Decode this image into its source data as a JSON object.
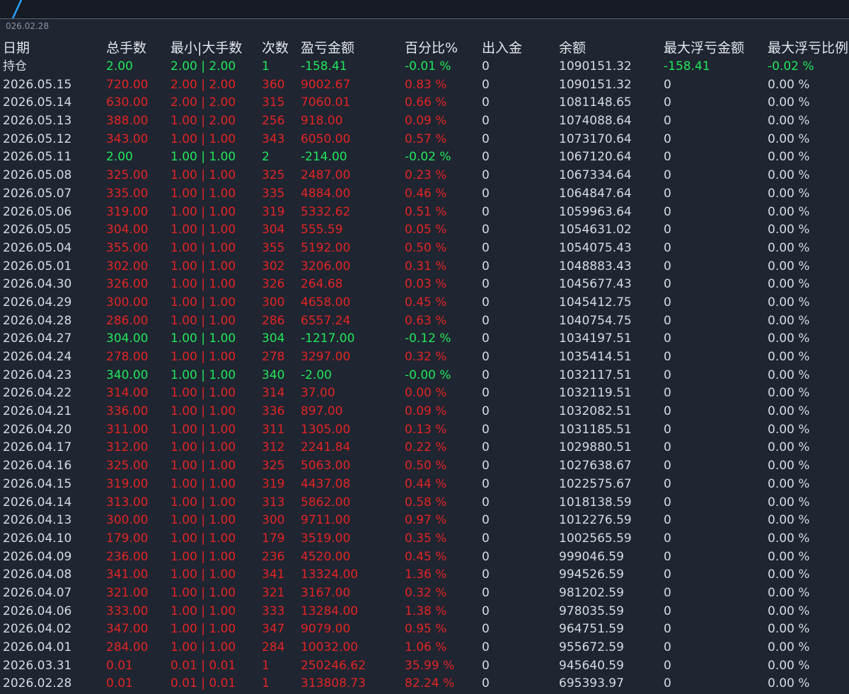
{
  "date_tag": "026.02.28",
  "columns": [
    "日期",
    "总手数",
    "最小|大手数",
    "次数",
    "盈亏金额",
    "百分比%",
    "出入金",
    "余额",
    "最大浮亏金额",
    "最大浮亏比例"
  ],
  "colors": {
    "loss": "#e12525",
    "gain": "#22e65c",
    "neutral": "#d7dbe2",
    "background": "#1f2531"
  },
  "rows": [
    {
      "date": "持仓",
      "lots": "2.00",
      "minmax": "2.00 | 2.00",
      "count": "1",
      "pnl": "-158.41",
      "pct": "-0.01 %",
      "flow": "0",
      "balance": "1090151.32",
      "float_amt": "-158.41",
      "float_pct": "-0.02 %",
      "color": "gain",
      "float_color": "gain"
    },
    {
      "date": "2026.05.15",
      "lots": "720.00",
      "minmax": "2.00 | 2.00",
      "count": "360",
      "pnl": "9002.67",
      "pct": "0.83 %",
      "flow": "0",
      "balance": "1090151.32",
      "float_amt": "0",
      "float_pct": "0.00 %",
      "color": "loss",
      "float_color": "neutral"
    },
    {
      "date": "2026.05.14",
      "lots": "630.00",
      "minmax": "2.00 | 2.00",
      "count": "315",
      "pnl": "7060.01",
      "pct": "0.66 %",
      "flow": "0",
      "balance": "1081148.65",
      "float_amt": "0",
      "float_pct": "0.00 %",
      "color": "loss",
      "float_color": "neutral"
    },
    {
      "date": "2026.05.13",
      "lots": "388.00",
      "minmax": "1.00 | 2.00",
      "count": "256",
      "pnl": "918.00",
      "pct": "0.09 %",
      "flow": "0",
      "balance": "1074088.64",
      "float_amt": "0",
      "float_pct": "0.00 %",
      "color": "loss",
      "float_color": "neutral"
    },
    {
      "date": "2026.05.12",
      "lots": "343.00",
      "minmax": "1.00 | 1.00",
      "count": "343",
      "pnl": "6050.00",
      "pct": "0.57 %",
      "flow": "0",
      "balance": "1073170.64",
      "float_amt": "0",
      "float_pct": "0.00 %",
      "color": "loss",
      "float_color": "neutral"
    },
    {
      "date": "2026.05.11",
      "lots": "2.00",
      "minmax": "1.00 | 1.00",
      "count": "2",
      "pnl": "-214.00",
      "pct": "-0.02 %",
      "flow": "0",
      "balance": "1067120.64",
      "float_amt": "0",
      "float_pct": "0.00 %",
      "color": "gain",
      "float_color": "neutral"
    },
    {
      "date": "2026.05.08",
      "lots": "325.00",
      "minmax": "1.00 | 1.00",
      "count": "325",
      "pnl": "2487.00",
      "pct": "0.23 %",
      "flow": "0",
      "balance": "1067334.64",
      "float_amt": "0",
      "float_pct": "0.00 %",
      "color": "loss",
      "float_color": "neutral"
    },
    {
      "date": "2026.05.07",
      "lots": "335.00",
      "minmax": "1.00 | 1.00",
      "count": "335",
      "pnl": "4884.00",
      "pct": "0.46 %",
      "flow": "0",
      "balance": "1064847.64",
      "float_amt": "0",
      "float_pct": "0.00 %",
      "color": "loss",
      "float_color": "neutral"
    },
    {
      "date": "2026.05.06",
      "lots": "319.00",
      "minmax": "1.00 | 1.00",
      "count": "319",
      "pnl": "5332.62",
      "pct": "0.51 %",
      "flow": "0",
      "balance": "1059963.64",
      "float_amt": "0",
      "float_pct": "0.00 %",
      "color": "loss",
      "float_color": "neutral"
    },
    {
      "date": "2026.05.05",
      "lots": "304.00",
      "minmax": "1.00 | 1.00",
      "count": "304",
      "pnl": "555.59",
      "pct": "0.05 %",
      "flow": "0",
      "balance": "1054631.02",
      "float_amt": "0",
      "float_pct": "0.00 %",
      "color": "loss",
      "float_color": "neutral"
    },
    {
      "date": "2026.05.04",
      "lots": "355.00",
      "minmax": "1.00 | 1.00",
      "count": "355",
      "pnl": "5192.00",
      "pct": "0.50 %",
      "flow": "0",
      "balance": "1054075.43",
      "float_amt": "0",
      "float_pct": "0.00 %",
      "color": "loss",
      "float_color": "neutral"
    },
    {
      "date": "2026.05.01",
      "lots": "302.00",
      "minmax": "1.00 | 1.00",
      "count": "302",
      "pnl": "3206.00",
      "pct": "0.31 %",
      "flow": "0",
      "balance": "1048883.43",
      "float_amt": "0",
      "float_pct": "0.00 %",
      "color": "loss",
      "float_color": "neutral"
    },
    {
      "date": "2026.04.30",
      "lots": "326.00",
      "minmax": "1.00 | 1.00",
      "count": "326",
      "pnl": "264.68",
      "pct": "0.03 %",
      "flow": "0",
      "balance": "1045677.43",
      "float_amt": "0",
      "float_pct": "0.00 %",
      "color": "loss",
      "float_color": "neutral"
    },
    {
      "date": "2026.04.29",
      "lots": "300.00",
      "minmax": "1.00 | 1.00",
      "count": "300",
      "pnl": "4658.00",
      "pct": "0.45 %",
      "flow": "0",
      "balance": "1045412.75",
      "float_amt": "0",
      "float_pct": "0.00 %",
      "color": "loss",
      "float_color": "neutral"
    },
    {
      "date": "2026.04.28",
      "lots": "286.00",
      "minmax": "1.00 | 1.00",
      "count": "286",
      "pnl": "6557.24",
      "pct": "0.63 %",
      "flow": "0",
      "balance": "1040754.75",
      "float_amt": "0",
      "float_pct": "0.00 %",
      "color": "loss",
      "float_color": "neutral"
    },
    {
      "date": "2026.04.27",
      "lots": "304.00",
      "minmax": "1.00 | 1.00",
      "count": "304",
      "pnl": "-1217.00",
      "pct": "-0.12 %",
      "flow": "0",
      "balance": "1034197.51",
      "float_amt": "0",
      "float_pct": "0.00 %",
      "color": "gain",
      "float_color": "neutral"
    },
    {
      "date": "2026.04.24",
      "lots": "278.00",
      "minmax": "1.00 | 1.00",
      "count": "278",
      "pnl": "3297.00",
      "pct": "0.32 %",
      "flow": "0",
      "balance": "1035414.51",
      "float_amt": "0",
      "float_pct": "0.00 %",
      "color": "loss",
      "float_color": "neutral"
    },
    {
      "date": "2026.04.23",
      "lots": "340.00",
      "minmax": "1.00 | 1.00",
      "count": "340",
      "pnl": "-2.00",
      "pct": "-0.00 %",
      "flow": "0",
      "balance": "1032117.51",
      "float_amt": "0",
      "float_pct": "0.00 %",
      "color": "gain",
      "float_color": "neutral"
    },
    {
      "date": "2026.04.22",
      "lots": "314.00",
      "minmax": "1.00 | 1.00",
      "count": "314",
      "pnl": "37.00",
      "pct": "0.00 %",
      "flow": "0",
      "balance": "1032119.51",
      "float_amt": "0",
      "float_pct": "0.00 %",
      "color": "loss",
      "float_color": "neutral"
    },
    {
      "date": "2026.04.21",
      "lots": "336.00",
      "minmax": "1.00 | 1.00",
      "count": "336",
      "pnl": "897.00",
      "pct": "0.09 %",
      "flow": "0",
      "balance": "1032082.51",
      "float_amt": "0",
      "float_pct": "0.00 %",
      "color": "loss",
      "float_color": "neutral"
    },
    {
      "date": "2026.04.20",
      "lots": "311.00",
      "minmax": "1.00 | 1.00",
      "count": "311",
      "pnl": "1305.00",
      "pct": "0.13 %",
      "flow": "0",
      "balance": "1031185.51",
      "float_amt": "0",
      "float_pct": "0.00 %",
      "color": "loss",
      "float_color": "neutral"
    },
    {
      "date": "2026.04.17",
      "lots": "312.00",
      "minmax": "1.00 | 1.00",
      "count": "312",
      "pnl": "2241.84",
      "pct": "0.22 %",
      "flow": "0",
      "balance": "1029880.51",
      "float_amt": "0",
      "float_pct": "0.00 %",
      "color": "loss",
      "float_color": "neutral"
    },
    {
      "date": "2026.04.16",
      "lots": "325.00",
      "minmax": "1.00 | 1.00",
      "count": "325",
      "pnl": "5063.00",
      "pct": "0.50 %",
      "flow": "0",
      "balance": "1027638.67",
      "float_amt": "0",
      "float_pct": "0.00 %",
      "color": "loss",
      "float_color": "neutral"
    },
    {
      "date": "2026.04.15",
      "lots": "319.00",
      "minmax": "1.00 | 1.00",
      "count": "319",
      "pnl": "4437.08",
      "pct": "0.44 %",
      "flow": "0",
      "balance": "1022575.67",
      "float_amt": "0",
      "float_pct": "0.00 %",
      "color": "loss",
      "float_color": "neutral"
    },
    {
      "date": "2026.04.14",
      "lots": "313.00",
      "minmax": "1.00 | 1.00",
      "count": "313",
      "pnl": "5862.00",
      "pct": "0.58 %",
      "flow": "0",
      "balance": "1018138.59",
      "float_amt": "0",
      "float_pct": "0.00 %",
      "color": "loss",
      "float_color": "neutral"
    },
    {
      "date": "2026.04.13",
      "lots": "300.00",
      "minmax": "1.00 | 1.00",
      "count": "300",
      "pnl": "9711.00",
      "pct": "0.97 %",
      "flow": "0",
      "balance": "1012276.59",
      "float_amt": "0",
      "float_pct": "0.00 %",
      "color": "loss",
      "float_color": "neutral"
    },
    {
      "date": "2026.04.10",
      "lots": "179.00",
      "minmax": "1.00 | 1.00",
      "count": "179",
      "pnl": "3519.00",
      "pct": "0.35 %",
      "flow": "0",
      "balance": "1002565.59",
      "float_amt": "0",
      "float_pct": "0.00 %",
      "color": "loss",
      "float_color": "neutral"
    },
    {
      "date": "2026.04.09",
      "lots": "236.00",
      "minmax": "1.00 | 1.00",
      "count": "236",
      "pnl": "4520.00",
      "pct": "0.45 %",
      "flow": "0",
      "balance": "999046.59",
      "float_amt": "0",
      "float_pct": "0.00 %",
      "color": "loss",
      "float_color": "neutral"
    },
    {
      "date": "2026.04.08",
      "lots": "341.00",
      "minmax": "1.00 | 1.00",
      "count": "341",
      "pnl": "13324.00",
      "pct": "1.36 %",
      "flow": "0",
      "balance": "994526.59",
      "float_amt": "0",
      "float_pct": "0.00 %",
      "color": "loss",
      "float_color": "neutral"
    },
    {
      "date": "2026.04.07",
      "lots": "321.00",
      "minmax": "1.00 | 1.00",
      "count": "321",
      "pnl": "3167.00",
      "pct": "0.32 %",
      "flow": "0",
      "balance": "981202.59",
      "float_amt": "0",
      "float_pct": "0.00 %",
      "color": "loss",
      "float_color": "neutral"
    },
    {
      "date": "2026.04.06",
      "lots": "333.00",
      "minmax": "1.00 | 1.00",
      "count": "333",
      "pnl": "13284.00",
      "pct": "1.38 %",
      "flow": "0",
      "balance": "978035.59",
      "float_amt": "0",
      "float_pct": "0.00 %",
      "color": "loss",
      "float_color": "neutral"
    },
    {
      "date": "2026.04.02",
      "lots": "347.00",
      "minmax": "1.00 | 1.00",
      "count": "347",
      "pnl": "9079.00",
      "pct": "0.95 %",
      "flow": "0",
      "balance": "964751.59",
      "float_amt": "0",
      "float_pct": "0.00 %",
      "color": "loss",
      "float_color": "neutral"
    },
    {
      "date": "2026.04.01",
      "lots": "284.00",
      "minmax": "1.00 | 1.00",
      "count": "284",
      "pnl": "10032.00",
      "pct": "1.06 %",
      "flow": "0",
      "balance": "955672.59",
      "float_amt": "0",
      "float_pct": "0.00 %",
      "color": "loss",
      "float_color": "neutral"
    },
    {
      "date": "2026.03.31",
      "lots": "0.01",
      "minmax": "0.01 | 0.01",
      "count": "1",
      "pnl": "250246.62",
      "pct": "35.99 %",
      "flow": "0",
      "balance": "945640.59",
      "float_amt": "0",
      "float_pct": "0.00 %",
      "color": "loss",
      "float_color": "neutral"
    },
    {
      "date": "2026.02.28",
      "lots": "0.01",
      "minmax": "0.01 | 0.01",
      "count": "1",
      "pnl": "313808.73",
      "pct": "82.24 %",
      "flow": "0",
      "balance": "695393.97",
      "float_amt": "0",
      "float_pct": "0.00 %",
      "color": "loss",
      "float_color": "neutral"
    }
  ]
}
